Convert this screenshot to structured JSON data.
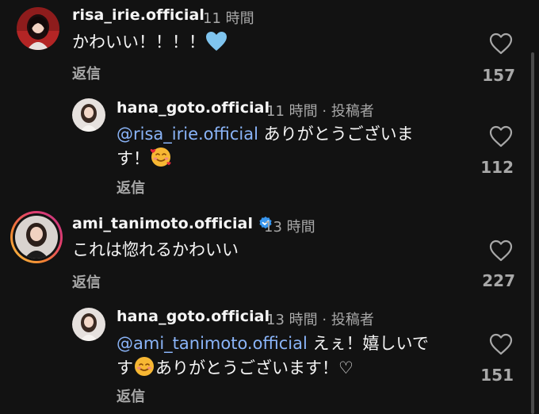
{
  "comments": [
    {
      "username": "risa_irie.official",
      "time": "11 時間",
      "text": "かわいい！！！！",
      "reply": "返信",
      "likes": "157"
    },
    {
      "username": "hana_goto.official",
      "time": "11 時間",
      "separator": "·",
      "author_tag": "投稿者",
      "mention": "@risa_irie.official",
      "text_line1": " ありがとうございま",
      "text_line2": "す！",
      "reply": "返信",
      "likes": "112"
    },
    {
      "username": "ami_tanimoto.official",
      "time": "13 時間",
      "text": "これは惚れるかわいい",
      "reply": "返信",
      "likes": "227"
    },
    {
      "username": "hana_goto.official",
      "time": "13 時間",
      "separator": "·",
      "author_tag": "投稿者",
      "mention": "@ami_tanimoto.official",
      "text_line1": " えぇ！嬉しいで",
      "text_line2a": "す",
      "text_line2b": "ありがとうございます！♡",
      "reply": "返信",
      "likes": "151"
    }
  ],
  "icons": {
    "like": "heart-icon",
    "verified": "verified-badge-icon",
    "emoji_blue_heart": "blue-heart-emoji",
    "emoji_hearts_face": "smiling-face-with-hearts-emoji",
    "emoji_blush": "smiling-face-emoji"
  },
  "colors": {
    "background": "#121212",
    "text": "#f5f5f5",
    "secondary": "#a8a8a8",
    "mention": "#8ab4f8",
    "verified": "#3897f0"
  }
}
